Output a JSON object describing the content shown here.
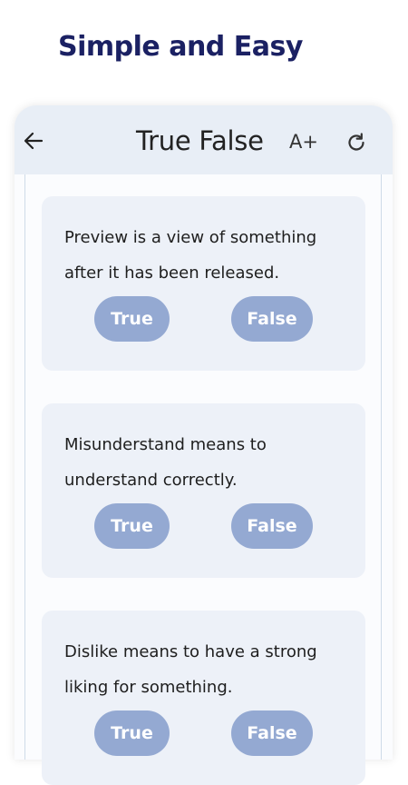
{
  "headline": "Simple and Easy",
  "appbar": {
    "title": "True False",
    "font_size_label": "A+",
    "back_icon": "arrow-left-icon",
    "refresh_icon": "refresh-icon"
  },
  "questions": [
    {
      "text": "Preview is a view of something after it has been released.",
      "true_label": "True",
      "false_label": "False"
    },
    {
      "text": "Misunderstand means to understand correctly.",
      "true_label": "True",
      "false_label": "False"
    },
    {
      "text": "Dislike means to have a strong liking for something.",
      "true_label": "True",
      "false_label": "False"
    }
  ],
  "colors": {
    "headline": "#1b2163",
    "appbar_bg": "#e8eef6",
    "card_bg": "#edf1f8",
    "button_bg": "#94a9d2",
    "button_text": "#ffffff"
  }
}
